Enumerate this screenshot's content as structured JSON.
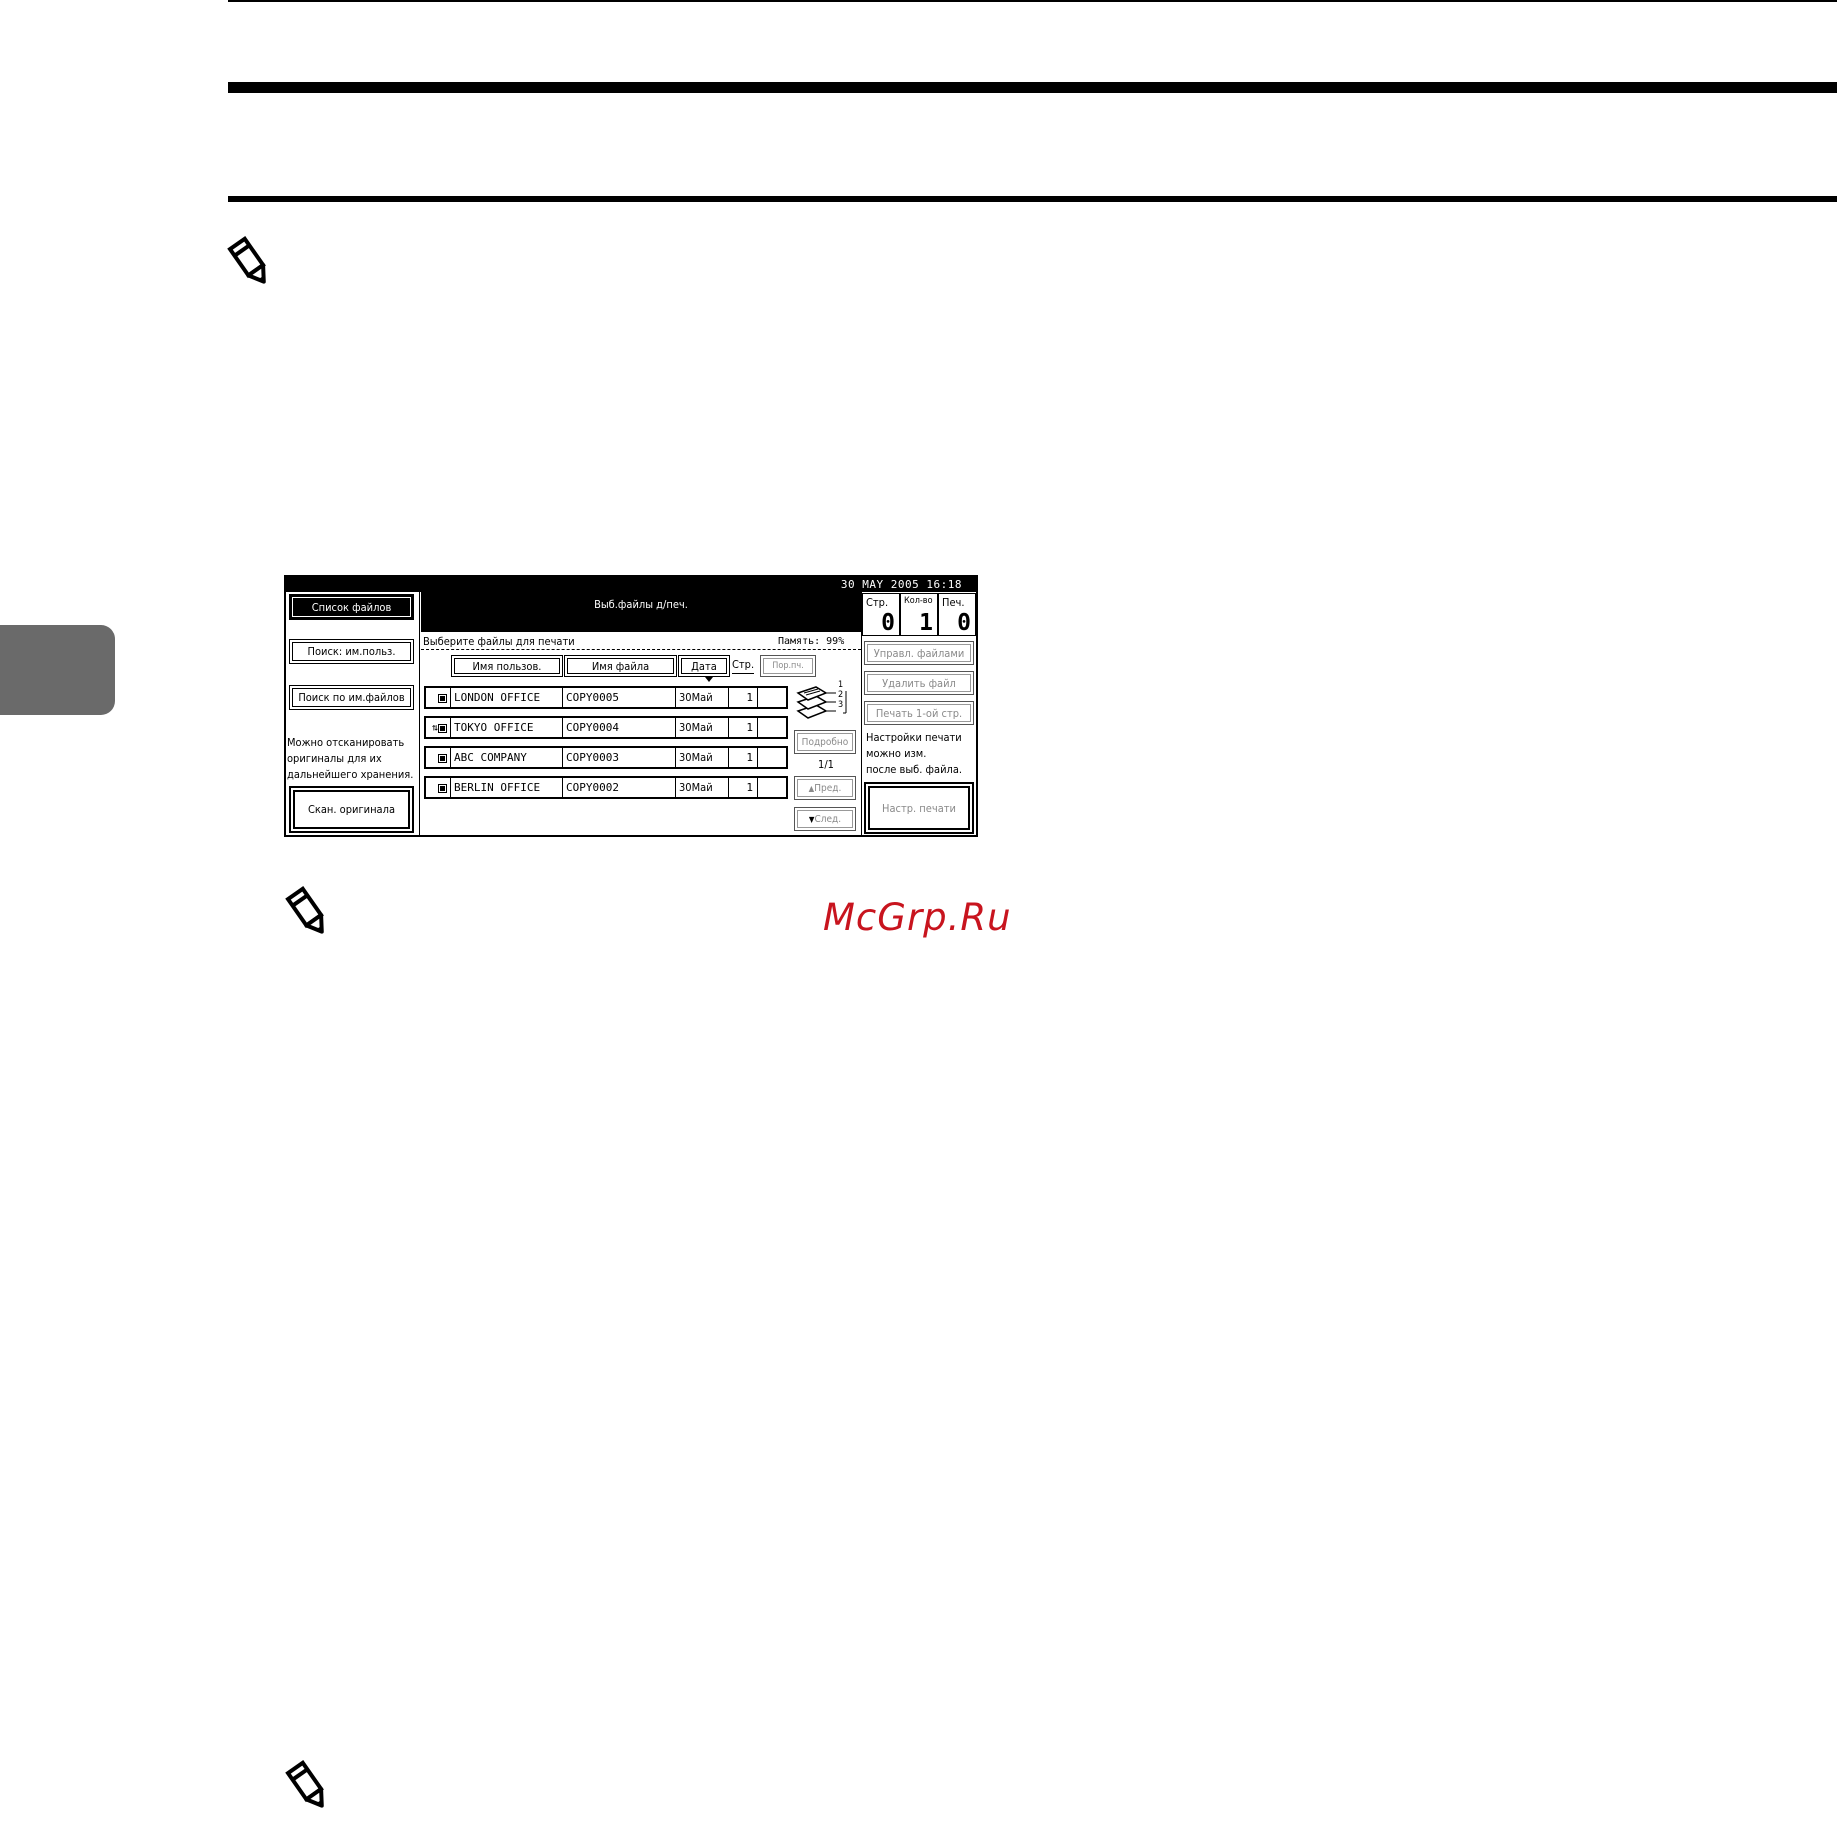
{
  "screen": {
    "datetime": "30 MAY  2005 16:18",
    "left_panel": {
      "file_list_tab": "Список файлов",
      "search_user_button": "Поиск: им.польз.",
      "search_file_button": "Поиск по им.файлов",
      "scan_hint_lines": [
        "Можно отсканировать",
        "оригиналы для их",
        "дальнейшего хранения."
      ],
      "scan_button": "Скан. оригинала"
    },
    "header": {
      "title": "Выб.файлы д/печ."
    },
    "subheader": {
      "instruction": "Выберите файлы для печати",
      "memory": "Память:  99%"
    },
    "columns": {
      "user": "Имя пользов.",
      "file": "Имя файла",
      "date": "Дата",
      "pages": "Стр.",
      "order": "Пор.пч."
    },
    "files": [
      {
        "icon": "doc",
        "user": "LONDON OFFICE",
        "file": "COPY0005",
        "date": "30Май",
        "pages": "1"
      },
      {
        "icon": "lock-doc",
        "user": "TOKYO OFFICE",
        "file": "COPY0004",
        "date": "30Май",
        "pages": "1"
      },
      {
        "icon": "doc",
        "user": "ABC COMPANY",
        "file": "COPY0003",
        "date": "30Май",
        "pages": "1"
      },
      {
        "icon": "doc",
        "user": "BERLIN OFFICE",
        "file": "COPY0002",
        "date": "30Май",
        "pages": "1"
      }
    ],
    "stack_labels": [
      "1",
      "2",
      "3"
    ],
    "details_button": "Подробно",
    "page_indicator": "1/1",
    "prev_button": "Пред.",
    "next_button": "След.",
    "counters": [
      {
        "label": "Стр.",
        "value": "0"
      },
      {
        "label": "Кол-во",
        "value": "1"
      },
      {
        "label": "Печ.",
        "value": "0"
      }
    ],
    "right_panel": {
      "manage_files_button": "Управл. файлами",
      "delete_file_button": "Удалить файл",
      "print_first_page_button": "Печать 1-ой стр.",
      "print_settings_hint_lines": [
        "Настройки печати",
        "можно изм.",
        "после выб. файла."
      ],
      "print_settings_button": "Настр. печати"
    }
  },
  "watermark": "McGrp.Ru"
}
